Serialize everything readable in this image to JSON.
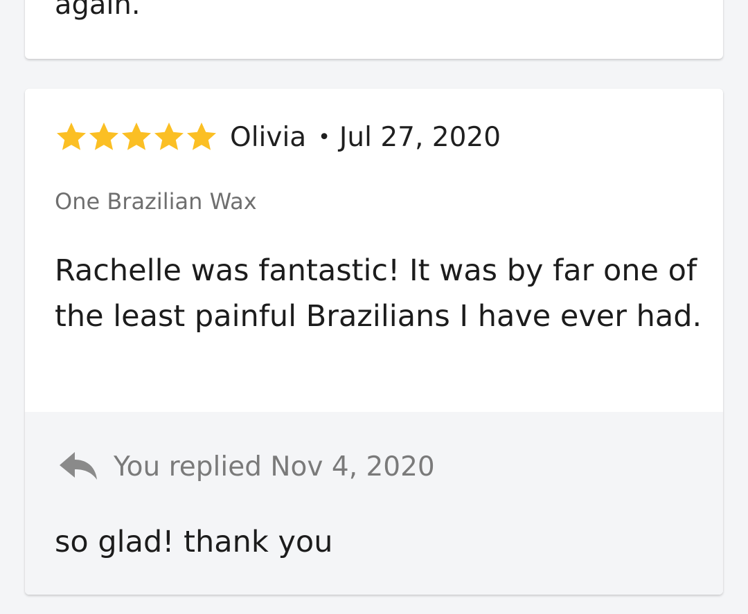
{
  "previous_review": {
    "body_tail": "again."
  },
  "review": {
    "rating": 5,
    "rating_max": 5,
    "star_color": "#fbbf24",
    "star_icon": "star-icon",
    "reviewer_name": "Olivia",
    "separator": "•",
    "date": "Jul 27, 2020",
    "service": "One Brazilian Wax",
    "body": "Rachelle was fantastic! It was by far one of the least painful Brazilians I have ever had."
  },
  "reply": {
    "icon": "reply-arrow-icon",
    "replied_label": "You replied Nov 4, 2020",
    "body": "so glad! thank you"
  }
}
